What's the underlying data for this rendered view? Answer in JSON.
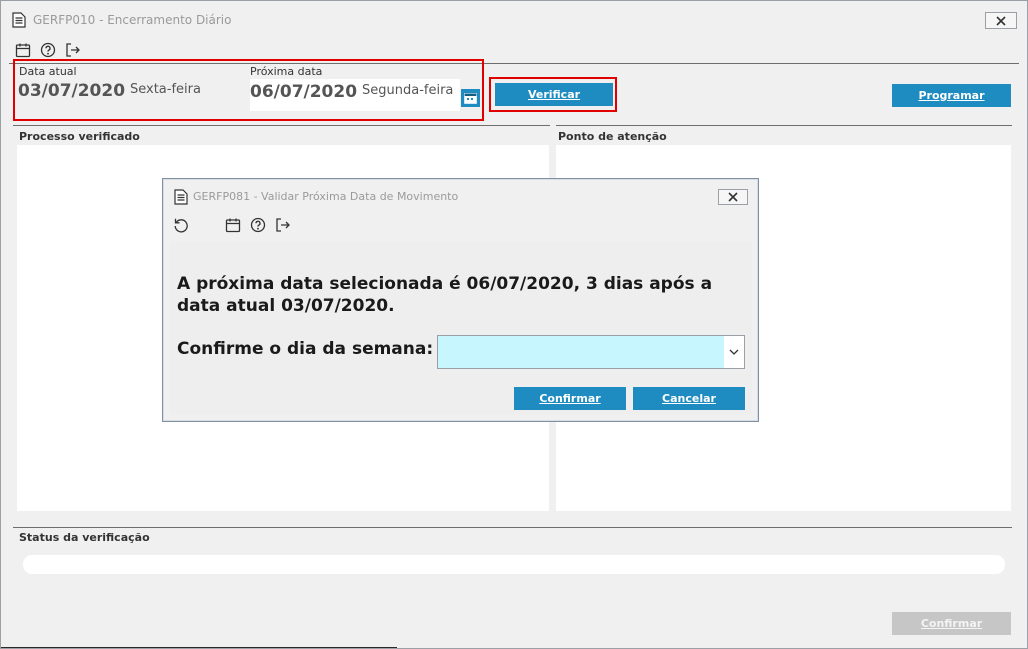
{
  "window": {
    "title": "GERFP010 - Encerramento Diário",
    "close_icon": "close-x-icon"
  },
  "toolbar": {
    "icons": [
      "calendar-icon",
      "help-icon",
      "exit-icon"
    ]
  },
  "current_date": {
    "label": "Data atual",
    "value": "03/07/2020",
    "weekday": "Sexta-feira"
  },
  "next_date": {
    "label": "Próxima data",
    "value": "06/07/2020",
    "weekday": "Segunda-feira",
    "picker_icon": "calendar-picker-icon"
  },
  "buttons": {
    "verify": "Verificar",
    "program": "Programar",
    "confirm": "Confirmar"
  },
  "sections": {
    "processed": "Processo verificado",
    "attention": "Ponto de atenção",
    "status": "Status da verificação"
  },
  "status": {
    "progress": 0
  },
  "dialog": {
    "title": "GERFP081 - Validar Próxima Data de Movimento",
    "toolbar_icons": [
      "refresh-icon",
      "calendar-icon",
      "help-icon",
      "exit-icon"
    ],
    "message": "A próxima data selecionada é 06/07/2020, 3 dias após a data atual 03/07/2020.",
    "confirm_label": "Confirme o dia da semana:",
    "select_value": "",
    "confirm_button": "Confirmar",
    "cancel_button": "Cancelar"
  },
  "colors": {
    "accent": "#1e8cc0",
    "highlight": "#e00000",
    "select_bg": "#c8f6ff",
    "disabled_button": "#c6c6c6"
  }
}
